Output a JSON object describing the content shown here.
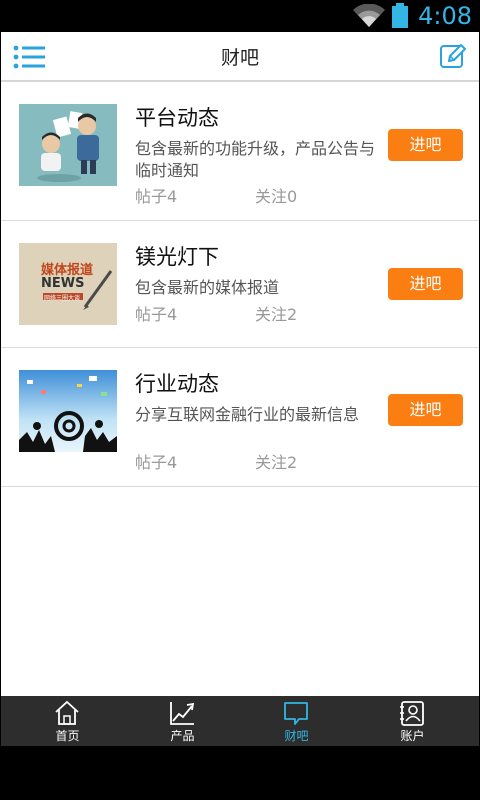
{
  "status": {
    "time": "4:08"
  },
  "header": {
    "title": "财吧"
  },
  "forums": [
    {
      "name": "平台动态",
      "desc": "包含最新的功能升级，产品公告与临时通知",
      "posts": "帖子4",
      "follows": "关注0",
      "button": "进吧"
    },
    {
      "name": "镁光灯下",
      "desc": "包含最新的媒体报道",
      "posts": "帖子4",
      "follows": "关注2",
      "button": "进吧",
      "thumb_text": "媒体报道",
      "thumb_news": "NEWS",
      "thumb_sub": "网络三圈大谈"
    },
    {
      "name": "行业动态",
      "desc": "分享互联网金融行业的最新信息",
      "posts": "帖子4",
      "follows": "关注2",
      "button": "进吧"
    }
  ],
  "tabs": [
    {
      "label": "首页",
      "icon": "home-icon"
    },
    {
      "label": "产品",
      "icon": "chart-icon"
    },
    {
      "label": "财吧",
      "icon": "chat-bubble-icon",
      "active": true
    },
    {
      "label": "账户",
      "icon": "contacts-icon"
    }
  ],
  "colors": {
    "accent": "#33b5e5",
    "button": "#fb7e12",
    "tabbar": "#2d2d2d"
  }
}
